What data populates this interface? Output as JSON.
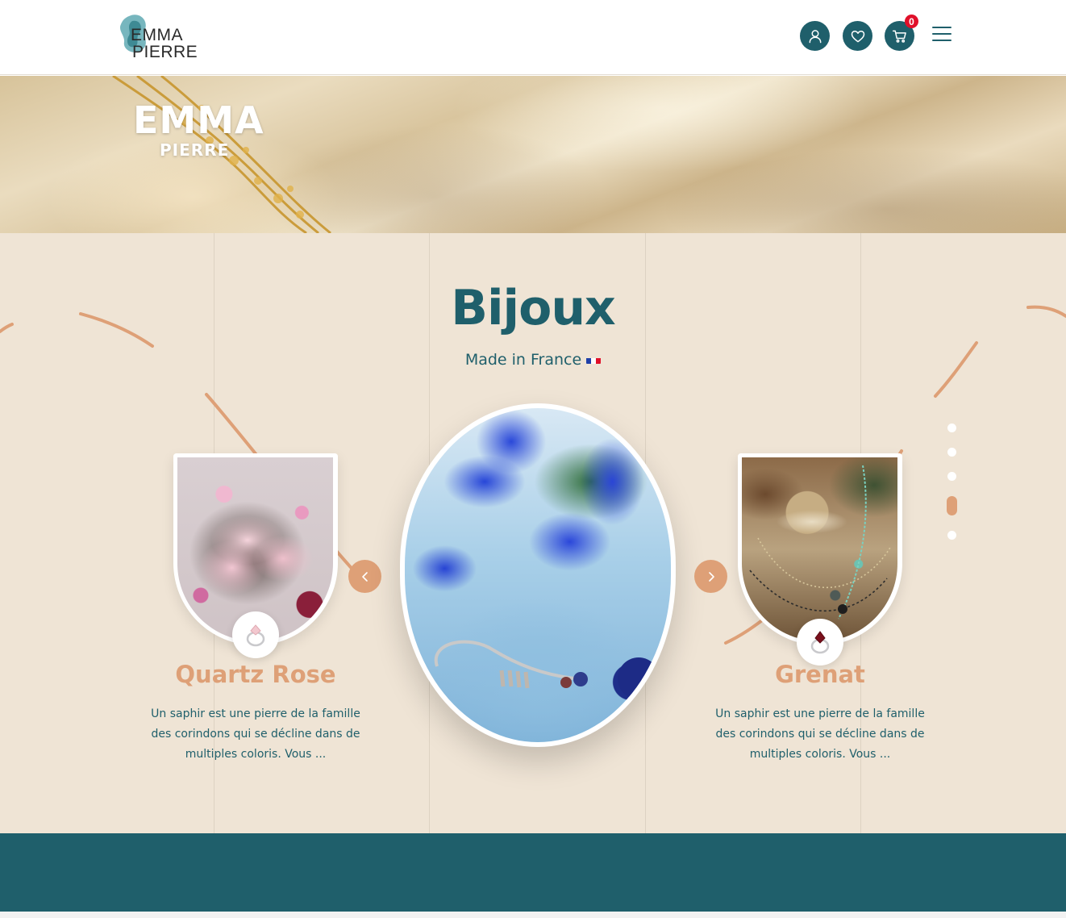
{
  "header": {
    "logo": {
      "line1": "EMMA",
      "line2": "PIERRE"
    },
    "account_icon": "user-icon",
    "wishlist_icon": "heart-icon",
    "cart_icon": "cart-icon",
    "cart_count": "0",
    "menu_icon": "hamburger-menu-icon"
  },
  "hero": {
    "title": "EMMA",
    "subtitle": "PIERRE"
  },
  "section": {
    "title": "Bijoux",
    "subtitle": "Made in France"
  },
  "carousel": {
    "prev_icon": "chevron-left-icon",
    "next_icon": "chevron-right-icon",
    "cards": [
      {
        "title": "Quartz Rose",
        "description": "Un saphir est une pierre de la famille des corindons qui se décline dans de multiples coloris. Vous ...",
        "ring_icon": "ring-icon"
      },
      {
        "title": "Grenat",
        "description": "Un saphir est une pierre de la famille des corindons qui se décline dans de multiples coloris. Vous ...",
        "ring_icon": "ring-icon"
      }
    ],
    "pagination": {
      "count": 5,
      "active_index": 3
    }
  },
  "colors": {
    "brand_teal": "#1f5f6b",
    "accent_peach": "#dea077",
    "section_bg": "#efe4d5",
    "badge_red": "#e0102a"
  }
}
